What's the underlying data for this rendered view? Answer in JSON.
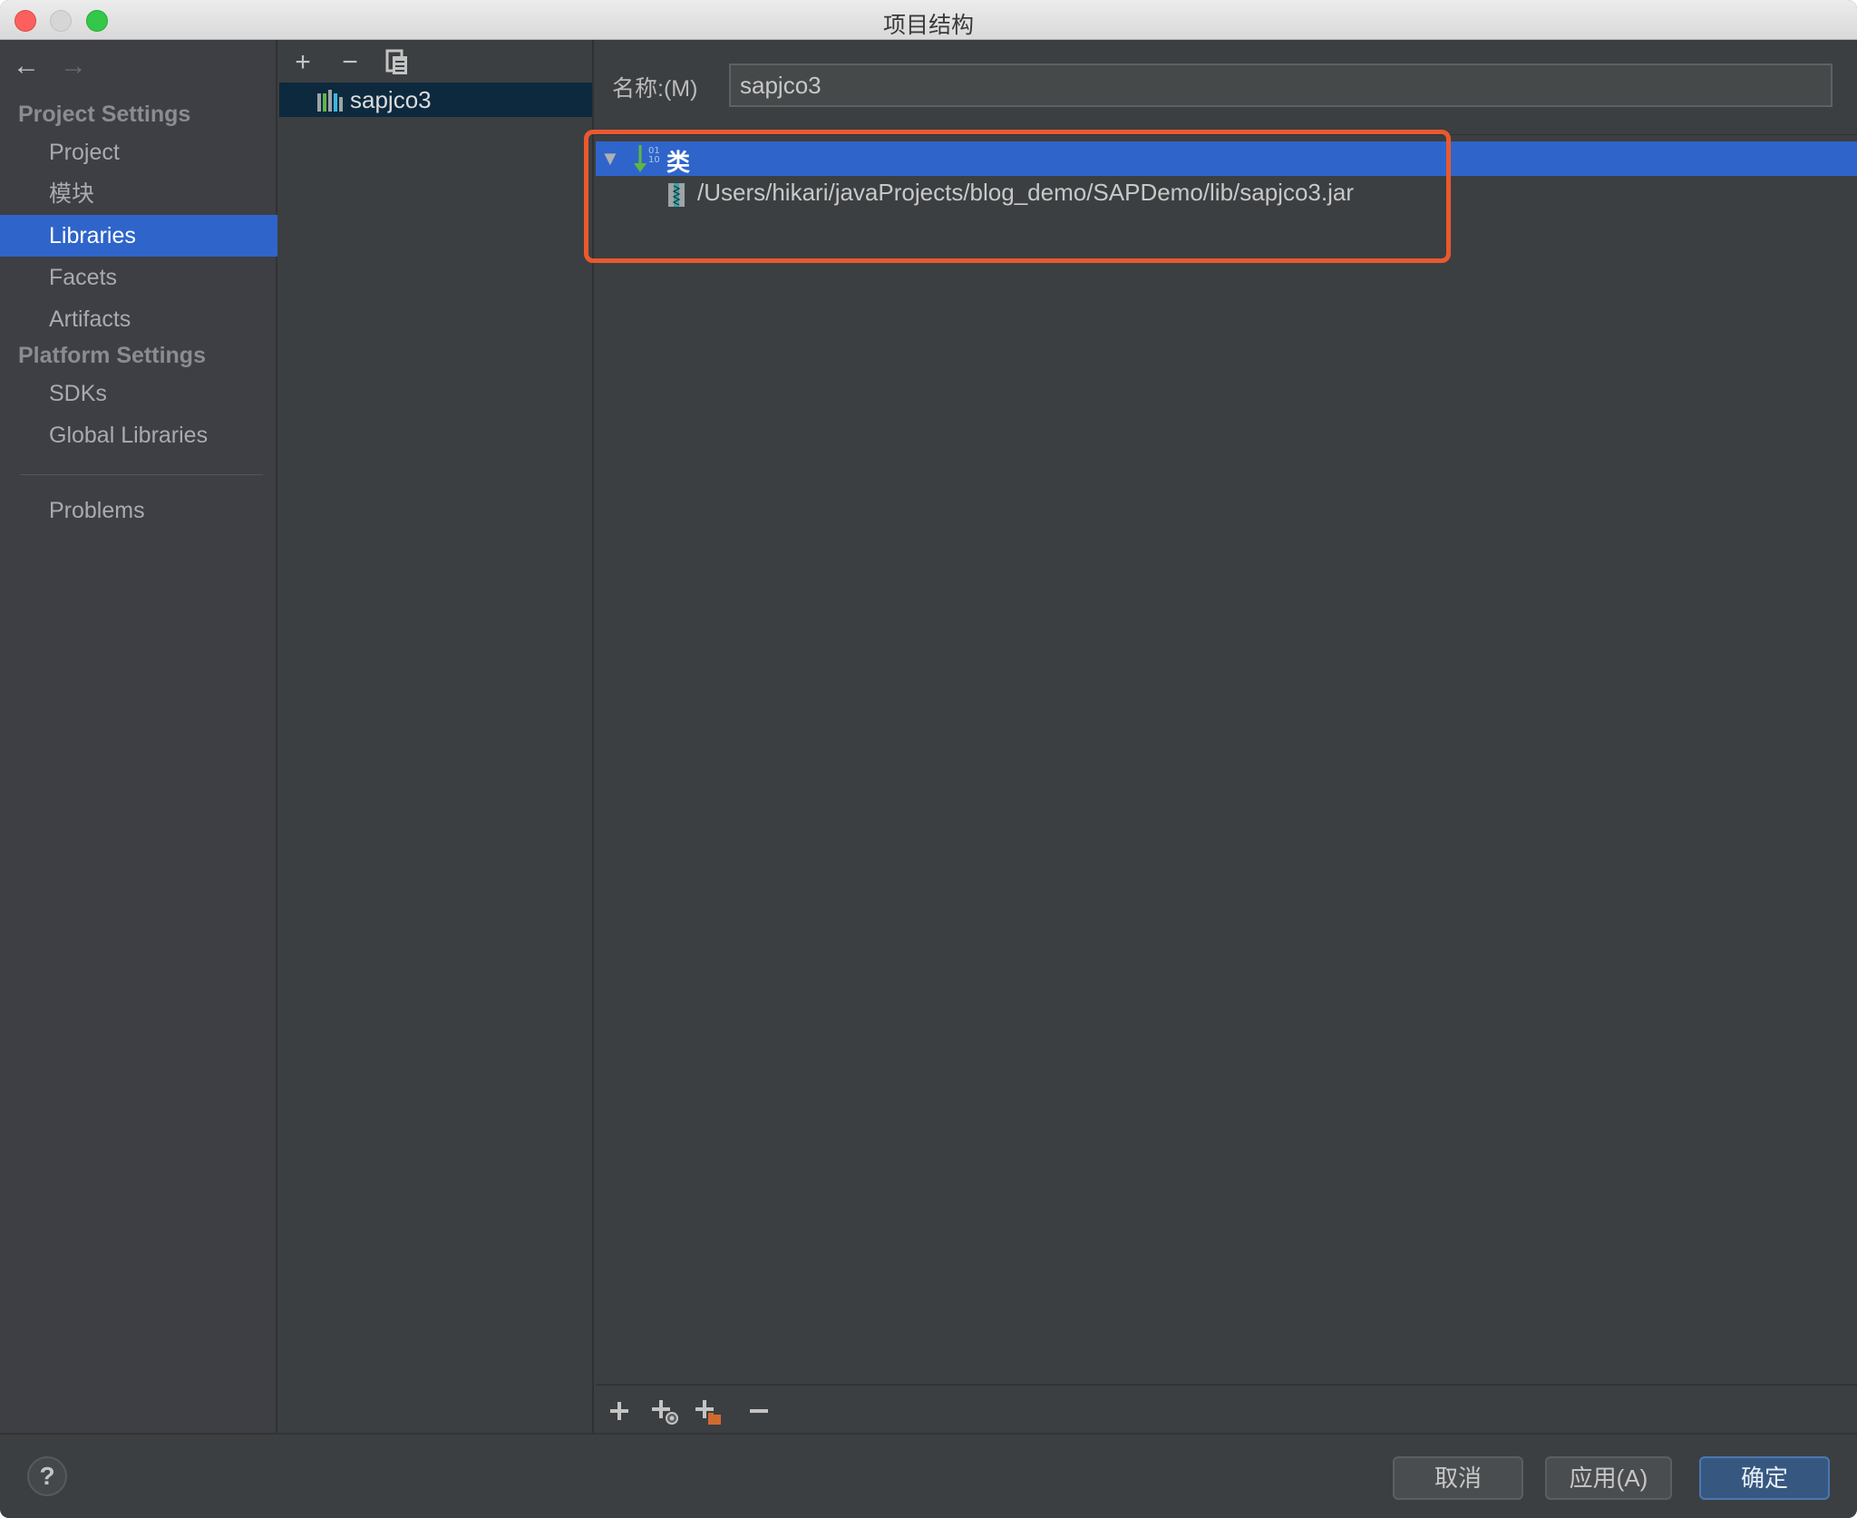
{
  "window": {
    "title": "项目结构"
  },
  "sidebar": {
    "nav": {
      "back_icon": "arrow-left-icon",
      "forward_icon": "arrow-right-icon"
    },
    "sections": [
      {
        "header": "Project Settings",
        "items": [
          {
            "label": "Project",
            "selected": false
          },
          {
            "label": "模块",
            "selected": false
          },
          {
            "label": "Libraries",
            "selected": true
          },
          {
            "label": "Facets",
            "selected": false
          },
          {
            "label": "Artifacts",
            "selected": false
          }
        ]
      },
      {
        "header": "Platform Settings",
        "items": [
          {
            "label": "SDKs",
            "selected": false
          },
          {
            "label": "Global Libraries",
            "selected": false
          }
        ]
      }
    ],
    "problems_label": "Problems"
  },
  "libraries_panel": {
    "toolbar": [
      "add-icon",
      "remove-icon",
      "copy-icon"
    ],
    "items": [
      {
        "name": "sapjco3",
        "selected": true
      }
    ]
  },
  "detail": {
    "name_label": "名称:(M)",
    "name_value": "sapjco3",
    "tree": {
      "root": {
        "label": "类",
        "expanded": true,
        "selected": true
      },
      "children": [
        {
          "path": "/Users/hikari/javaProjects/blog_demo/SAPDemo/lib/sapjco3.jar"
        }
      ]
    },
    "bottom_toolbar": [
      "add-icon",
      "add-url-icon",
      "add-folder-icon",
      "remove-icon"
    ],
    "highlight_color": "#e9592f"
  },
  "footer": {
    "help_label": "?",
    "cancel_label": "取消",
    "apply_label": "应用(A)",
    "ok_label": "确定"
  },
  "colors": {
    "selection": "#2f65ca",
    "list_selection": "#0d293e",
    "background": "#3c3f41",
    "primary_button": "#365880"
  }
}
